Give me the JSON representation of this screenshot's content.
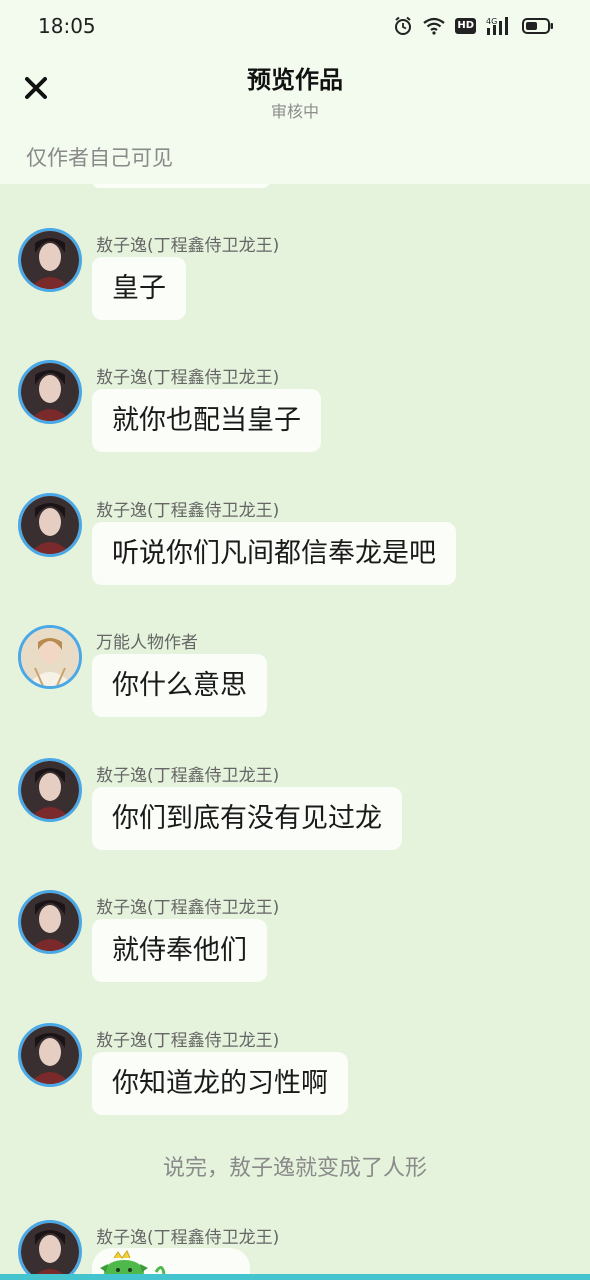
{
  "status_bar": {
    "time": "18:05",
    "hd_label": "HD",
    "network_label": "4G",
    "icons": [
      "alarm-icon",
      "wifi-icon",
      "hd-icon",
      "signal-icon",
      "battery-icon"
    ]
  },
  "header": {
    "title": "预览作品",
    "subtitle": "审核中",
    "visibility_note": "仅作者自己可见",
    "close_icon": "close-icon"
  },
  "messages": [
    {
      "sender": "敖子逸(丁程鑫侍卫龙王)",
      "text": "皇子"
    },
    {
      "sender": "敖子逸(丁程鑫侍卫龙王)",
      "text": "就你也配当皇子"
    },
    {
      "sender": "敖子逸(丁程鑫侍卫龙王)",
      "text": "听说你们凡间都信奉龙是吧"
    },
    {
      "sender": "万能人物作者",
      "text": "你什么意思"
    },
    {
      "sender": "敖子逸(丁程鑫侍卫龙王)",
      "text": "你们到底有没有见过龙"
    },
    {
      "sender": "敖子逸(丁程鑫侍卫龙王)",
      "text": "就侍奉他们"
    },
    {
      "sender": "敖子逸(丁程鑫侍卫龙王)",
      "text": "你知道龙的习性啊"
    }
  ],
  "narration": "说完，敖子逸就变成了人形",
  "last_message": {
    "sender": "敖子逸(丁程鑫侍卫龙王)",
    "sticker": "dragon-sticker-icon"
  },
  "colors": {
    "background": "#e5f3dc",
    "header_background": "#f2fbee",
    "bubble": "#fbfdf8",
    "avatar_ring": "#4aa8e6",
    "bottom_strip": "#43c4cf"
  }
}
